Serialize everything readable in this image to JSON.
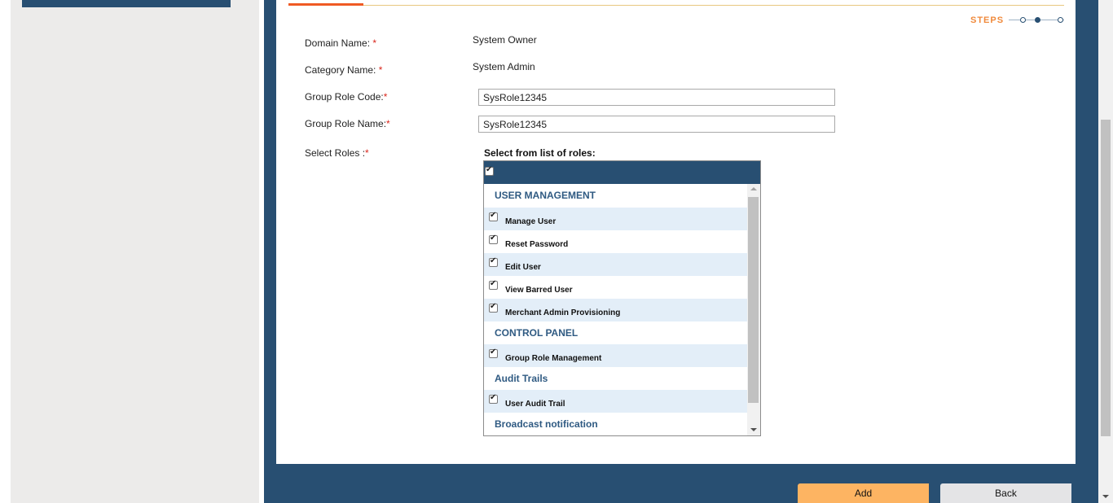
{
  "steps": {
    "label": "STEPS",
    "total": 3,
    "current": 2
  },
  "form": {
    "domain_label": "Domain Name:",
    "domain_value": "System Owner",
    "category_label": "Category Name:",
    "category_value": "System Admin",
    "role_code_label": "Group Role Code:",
    "role_code_value": "SysRole12345",
    "role_name_label": "Group Role Name:",
    "role_name_value": "SysRole12345",
    "select_roles_label": "Select Roles :",
    "required_marker": "*"
  },
  "roles": {
    "title": "Select from list of roles:",
    "select_all_checked": true,
    "groups": [
      {
        "name": "USER MANAGEMENT",
        "items": [
          {
            "label": "Manage User",
            "checked": true
          },
          {
            "label": "Reset Password",
            "checked": true
          },
          {
            "label": "Edit User",
            "checked": true
          },
          {
            "label": "View Barred User",
            "checked": true
          },
          {
            "label": "Merchant Admin Provisioning",
            "checked": true
          }
        ]
      },
      {
        "name": "CONTROL PANEL",
        "items": [
          {
            "label": "Group Role Management",
            "checked": true
          }
        ]
      },
      {
        "name": "Audit Trails",
        "items": [
          {
            "label": "User Audit Trail",
            "checked": true
          }
        ]
      },
      {
        "name": "Broadcast notification",
        "items": []
      }
    ]
  },
  "buttons": {
    "add": "Add",
    "back": "Back"
  },
  "colors": {
    "primary": "#284f72",
    "accent": "#ef5a24",
    "add_button": "#fdb462",
    "required": "#d9261c"
  }
}
